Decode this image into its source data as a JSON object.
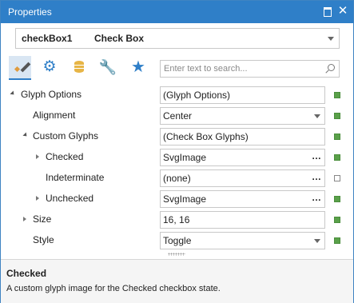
{
  "window": {
    "title": "Properties",
    "accent": "#2f7fc8"
  },
  "object_selector": {
    "name": "checkBox1",
    "type": "Check Box"
  },
  "toolbar": {
    "tabs": [
      {
        "icon": "brush-icon",
        "selected": true
      },
      {
        "icon": "gears-icon",
        "selected": false
      },
      {
        "icon": "database-icon",
        "selected": false
      },
      {
        "icon": "wrench-icon",
        "selected": false
      },
      {
        "icon": "star-icon",
        "selected": false
      }
    ]
  },
  "search": {
    "placeholder": "Enter text to search..."
  },
  "properties": [
    {
      "label": "Glyph Options",
      "value": "(Glyph Options)",
      "expander": "open",
      "editor": "text",
      "modified": true
    },
    {
      "label": "Alignment",
      "value": "Center",
      "expander": "none",
      "editor": "combo",
      "modified": true
    },
    {
      "label": "Custom Glyphs",
      "value": "(Check Box Glyphs)",
      "expander": "open",
      "editor": "text",
      "modified": true
    },
    {
      "label": "Checked",
      "value": "SvgImage",
      "expander": "closed",
      "editor": "ellipsis",
      "modified": true
    },
    {
      "label": "Indeterminate",
      "value": "(none)",
      "expander": "none",
      "editor": "ellipsis",
      "modified": false
    },
    {
      "label": "Unchecked",
      "value": "SvgImage",
      "expander": "closed",
      "editor": "ellipsis",
      "modified": true
    },
    {
      "label": "Size",
      "value": "16, 16",
      "expander": "closed",
      "editor": "text",
      "modified": true
    },
    {
      "label": "Style",
      "value": "Toggle",
      "expander": "none",
      "editor": "combo",
      "modified": true
    }
  ],
  "ellipsis_label": "…",
  "description": {
    "title": "Checked",
    "text": "A custom glyph image for the Checked checkbox state."
  }
}
